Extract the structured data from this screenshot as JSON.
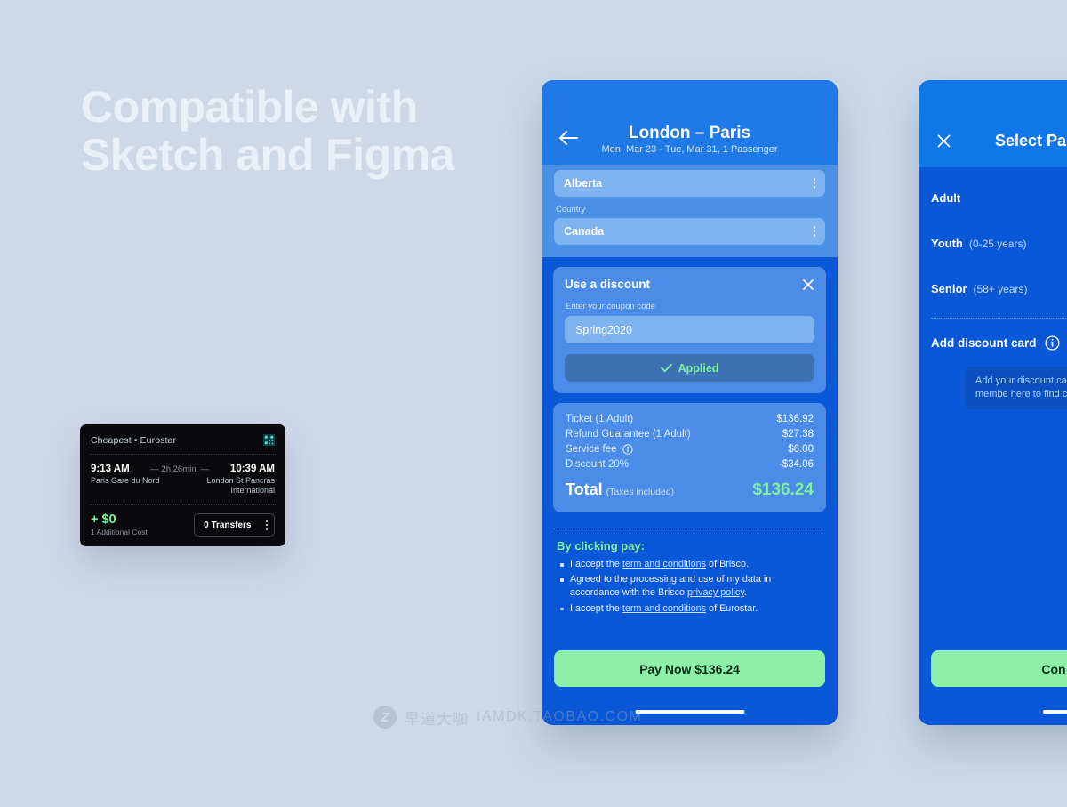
{
  "headline": {
    "line1": "Compatible with",
    "line2": "Sketch and Figma"
  },
  "colors": {
    "page_background": "#ced9e8",
    "phone_body": "#0a57d8",
    "header_blue": "#1f7ae8",
    "card_blue": "#4a8ce8",
    "field_blue": "#7eb3ef",
    "accent_green": "#8df0a8",
    "total_green": "#7ef0a0",
    "dark_card": "#0a0a0c"
  },
  "train_card": {
    "tag": "Cheapest • Eurostar",
    "icon": "qr-code-icon",
    "depart_time": "9:13 AM",
    "duration": "— 2h 26min. —",
    "arrive_time": "10:39 AM",
    "depart_place": "Paris Gare du Nord",
    "arrive_place": "London St Pancras International",
    "extra_cost": "+ $0",
    "extra_cost_note": "1 Additional Cost",
    "transfers": "0 Transfers",
    "transfers_menu_icon": "vertical-dots-icon"
  },
  "phone1": {
    "back_icon": "arrow-left-icon",
    "title": "London – Paris",
    "subtitle": "Mon, Mar 23 - Tue, Mar 31, 1 Passenger",
    "fields": {
      "state_value": "Alberta",
      "country_label": "Country",
      "country_value": "Canada",
      "menu_icon": "vertical-dots-icon"
    },
    "discount": {
      "title": "Use a discount",
      "close_icon": "close-icon",
      "input_label": "Enter your coupon code",
      "coupon_value": "Spring2020",
      "coupon_placeholder": "Enter your coupon code",
      "applied_label": "Applied",
      "applied_icon": "check-icon"
    },
    "price": {
      "rows": [
        {
          "label": "Ticket (1 Adult)",
          "value": "$136.92",
          "icon": ""
        },
        {
          "label": "Refund Guarantee (1 Adult)",
          "value": "$27.38",
          "icon": ""
        },
        {
          "label": "Service fee",
          "value": "$6.00",
          "icon": "info-icon"
        },
        {
          "label": "Discount 20%",
          "value": "-$34.06",
          "icon": ""
        }
      ],
      "total_label": "Total",
      "total_note": "(Taxes included)",
      "total_value": "$136.24"
    },
    "terms": {
      "heading": "By clicking pay:",
      "items": [
        {
          "pre": "I accept the ",
          "link": "term and conditions",
          "post": " of Brisco."
        },
        {
          "pre": "Agreed to the processing and use of my data in accordance with the Brisco ",
          "link": "privacy policy",
          "post": "."
        },
        {
          "pre": "I accept the ",
          "link": "term and conditions",
          "post": " of Eurostar."
        }
      ]
    },
    "pay_button": "Pay Now $136.24"
  },
  "phone2": {
    "close_icon": "close-icon",
    "title": "Select Pa",
    "passengers": [
      {
        "name": "Adult",
        "age": ""
      },
      {
        "name": "Youth",
        "age": "(0-25 years)"
      },
      {
        "name": "Senior",
        "age": "(58+ years)"
      }
    ],
    "discount_card_label": "Add discount card",
    "discount_info_icon": "info-icon",
    "tooltip": "Add your discount car (e.g. loyalty or membe here to find cheaper t",
    "continue_button": "Con"
  },
  "watermark": {
    "logo": "Z",
    "chinese": "早道大咖",
    "english": "IAMDK.TAOBAO.COM"
  }
}
